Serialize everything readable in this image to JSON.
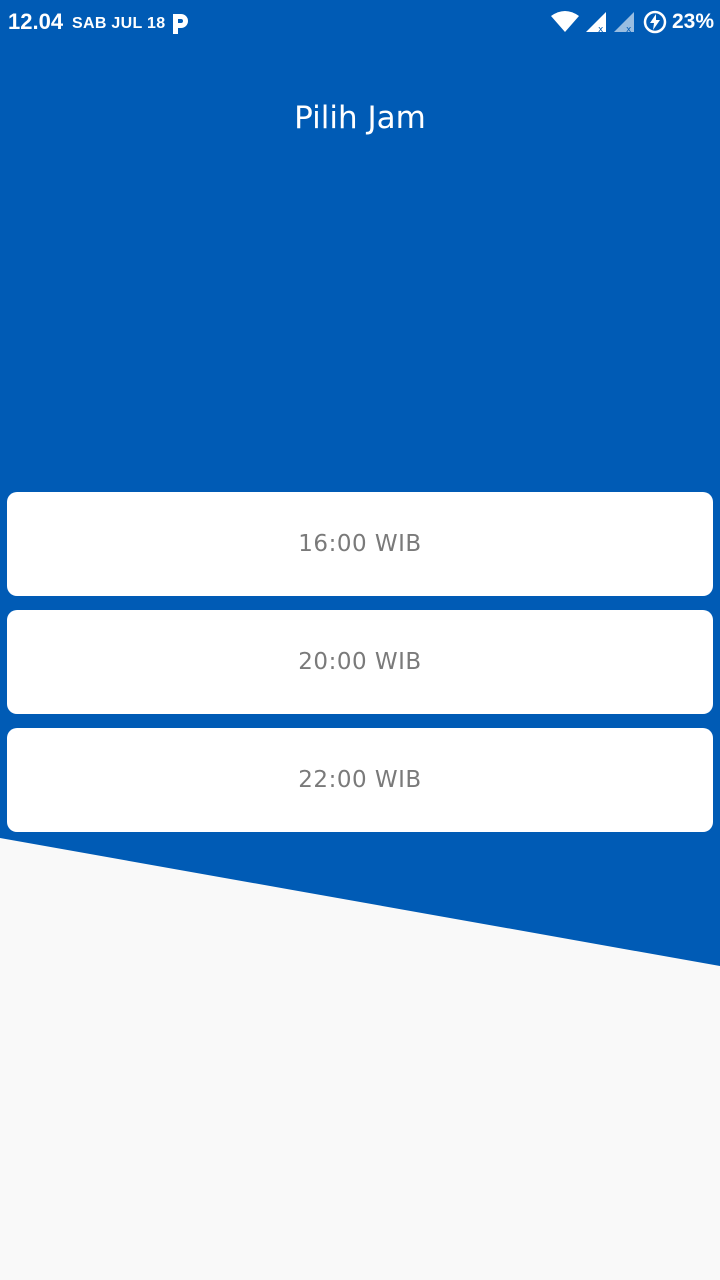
{
  "status_bar": {
    "time": "12.04",
    "date": "SAB JUL 18",
    "battery_percent": "23%",
    "icons": [
      "parking-app-icon",
      "wifi-icon",
      "signal-icon",
      "signal-icon",
      "battery-charging-icon"
    ]
  },
  "header": {
    "title": "Pilih Jam"
  },
  "time_options": [
    {
      "label": "16:00 WIB"
    },
    {
      "label": "20:00 WIB"
    },
    {
      "label": "22:00 WIB"
    }
  ],
  "colors": {
    "primary": "#005BB5",
    "card": "#FFFFFF",
    "background": "#F9F9F9",
    "option_text": "#7A7A7A"
  }
}
